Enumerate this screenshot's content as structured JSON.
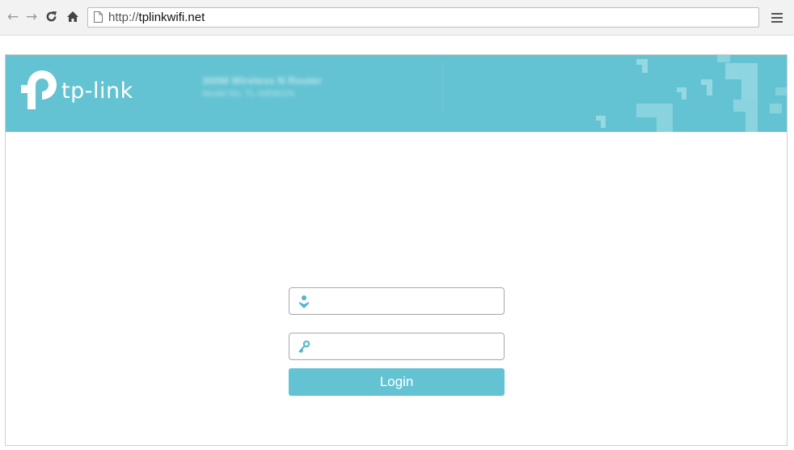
{
  "browser": {
    "url_protocol": "http://",
    "url_host": "tplinkwifi.net",
    "back_icon": "arrow-left-icon",
    "forward_icon": "arrow-right-icon",
    "reload_icon": "reload-icon",
    "home_icon": "home-icon",
    "page_icon": "page-icon",
    "menu_icon": "hamburger-menu-icon"
  },
  "header": {
    "brand": "tp-link",
    "model_title": "300M Wireless N Router",
    "model_number": "Model No. TL-WR841N",
    "accent_color": "#64c3d2"
  },
  "login": {
    "username_value": "",
    "password_value": "",
    "username_icon": "user-icon",
    "password_icon": "key-icon",
    "button_label": "Login"
  }
}
